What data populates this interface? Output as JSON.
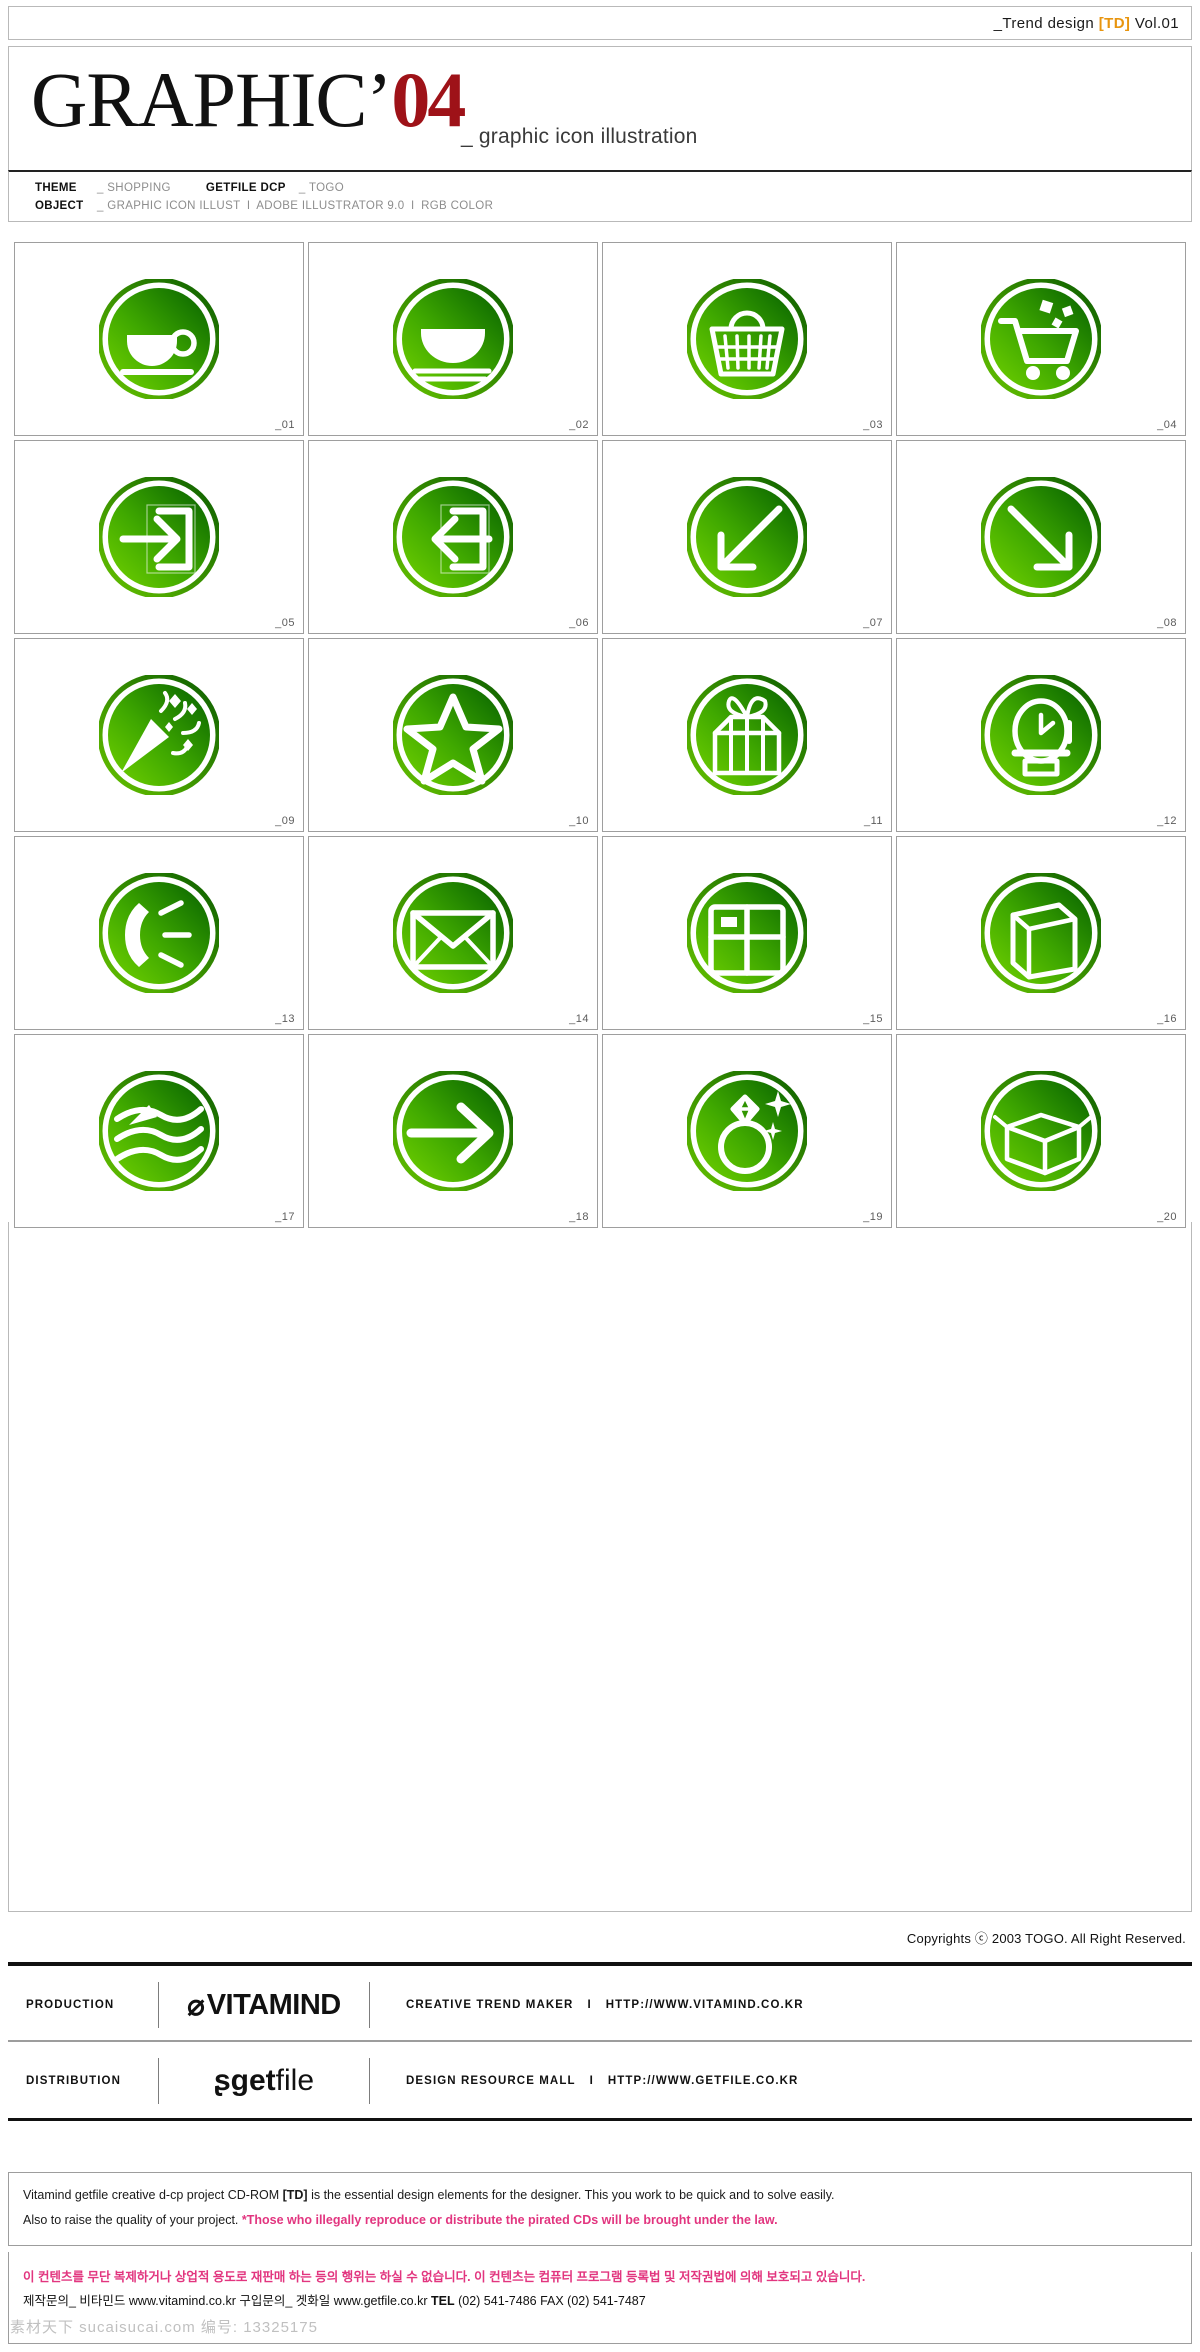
{
  "header": {
    "volume_prefix": "_Trend design ",
    "volume_td": "[TD]",
    "volume_suffix": " Vol.01",
    "title_main": "GRAPHIC’",
    "title_year": "04",
    "subtitle": "_ graphic icon illustration"
  },
  "meta": {
    "theme_key": "THEME",
    "theme_v1": "_ SHOPPING",
    "theme_v2": "GETFILE DCP",
    "theme_v3": "_ TOGO",
    "object_key": "OBJECT",
    "object_v1": "_ GRAPHIC ICON ILLUST",
    "object_v2": "ADOBE ILLUSTRATOR 9.0",
    "object_v3": "RGB COLOR",
    "separator": "I"
  },
  "grid": {
    "accent_light": "#5cc000",
    "accent_dark": "#0c6b00",
    "items": [
      {
        "num": "_01",
        "icon": "coffee-cup-icon"
      },
      {
        "num": "_02",
        "icon": "rice-bowl-chopsticks-icon"
      },
      {
        "num": "_03",
        "icon": "shopping-basket-icon"
      },
      {
        "num": "_04",
        "icon": "shopping-cart-icon"
      },
      {
        "num": "_05",
        "icon": "login-arrow-icon"
      },
      {
        "num": "_06",
        "icon": "logout-arrow-icon"
      },
      {
        "num": "_07",
        "icon": "arrow-down-left-icon"
      },
      {
        "num": "_08",
        "icon": "arrow-down-right-icon"
      },
      {
        "num": "_09",
        "icon": "party-popper-icon"
      },
      {
        "num": "_10",
        "icon": "star-icon"
      },
      {
        "num": "_11",
        "icon": "gift-box-icon"
      },
      {
        "num": "_12",
        "icon": "wristwatch-icon"
      },
      {
        "num": "_13",
        "icon": "telephone-ringing-icon"
      },
      {
        "num": "_14",
        "icon": "envelope-mail-icon"
      },
      {
        "num": "_15",
        "icon": "window-pane-icon"
      },
      {
        "num": "_16",
        "icon": "shopping-bag-icon"
      },
      {
        "num": "_17",
        "icon": "flowing-paper-icon"
      },
      {
        "num": "_18",
        "icon": "arrow-right-icon"
      },
      {
        "num": "_19",
        "icon": "diamond-ring-icon"
      },
      {
        "num": "_20",
        "icon": "open-carton-box-icon"
      }
    ]
  },
  "copyright": "Copyrights ⓒ 2003 TOGO. All Right Reserved.",
  "partners": [
    {
      "label": "PRODUCTION",
      "logo_mark": "⌀",
      "logo_text": "VITAMIND",
      "desc": "CREATIVE TREND MAKER",
      "separator": "I",
      "url": "HTTP://WWW.VITAMIND.CO.KR"
    },
    {
      "label": "DISTRIBUTION",
      "logo_mark": "ʂ",
      "logo_text_bold": "get",
      "logo_text_light": "file",
      "desc": "DESIGN RESOURCE MALL",
      "separator": "I",
      "url": "HTTP://WWW.GETFILE.CO.KR"
    }
  ],
  "notice": {
    "line1_a": "Vitamind getfile creative d-cp project CD-ROM ",
    "line1_b": "[TD]",
    "line1_c": " is the essential design elements for the designer. This you work to be quick and to solve easily.",
    "line2_a": "Also to raise the quality of your project. ",
    "line2_b": "*Those who illegally reproduce or distribute the pirated CDs will be brought under the law."
  },
  "korean": {
    "line1": "이 컨텐츠를 무단 복제하거나 상업적 용도로 재판매 하는 등의 행위는 하실 수 없습니다. 이 컨텐츠는 컴퓨터 프로그램 등록법 및 저작권법에 의해 보호되고 있습니다.",
    "line2_a": "제작문의_ 비타민드 www.vitamind.co.kr  구입문의_ 겟화일 www.getfile.co.kr   ",
    "line2_tel": "TEL",
    "line2_b": " (02) 541-7486 FAX (02) 541-7487"
  },
  "watermark": "素材天下 sucaisucai.com 编号: 13325175"
}
